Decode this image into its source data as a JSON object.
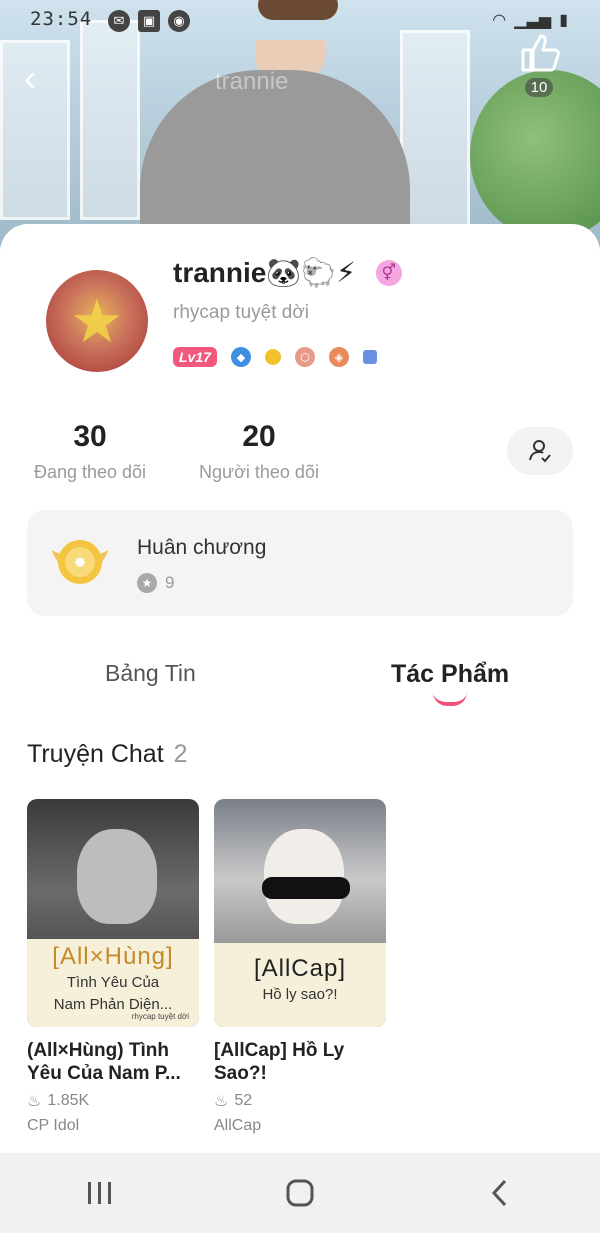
{
  "status_bar": {
    "time": "23:54",
    "icons": [
      "messenger-icon",
      "gallery-icon",
      "app-icon"
    ],
    "right_icons": [
      "wifi-icon",
      "signal-icon",
      "battery-icon"
    ]
  },
  "header": {
    "like_count": "10",
    "watermark": "trannie"
  },
  "profile": {
    "username": "trannie🐼🐑⚡",
    "bio": "rhycap tuyệt dời",
    "level": "Lv17",
    "badges": [
      "diamond-badge",
      "coin-badge",
      "hex-badge",
      "shield-badge",
      "card-badge"
    ]
  },
  "stats": {
    "following": {
      "count": "30",
      "label": "Đang theo dõi"
    },
    "followers": {
      "count": "20",
      "label": "Người theo dõi"
    }
  },
  "medals": {
    "title": "Huân chương",
    "count": "9"
  },
  "tabs": {
    "feed": "Bảng Tin",
    "works": "Tác Phẩm",
    "active": "works"
  },
  "section": {
    "title": "Truyện Chat",
    "count": "2"
  },
  "stories": [
    {
      "cover_title": "[All×Hùng]",
      "cover_subtitle_1": "Tình Yêu Của",
      "cover_subtitle_2": "Nam Phản Diện...",
      "cover_credit": "rhycap tuyệt dời",
      "title": "(All×Hùng) Tình Yêu Của Nam P...",
      "views": "1.85K",
      "category": "CP Idol"
    },
    {
      "cover_title": "[AllCap]",
      "cover_subtitle_1": "Hồ ly sao?!",
      "title": "[AllCap] Hồ Ly Sao?!",
      "views": "52",
      "category": "AllCap"
    }
  ],
  "navbar": {
    "items": [
      "recent-apps",
      "home",
      "back"
    ]
  },
  "colors": {
    "accent": "#f0527a",
    "level_badge": "#f2577c",
    "card_bg": "#f4f4f4"
  }
}
